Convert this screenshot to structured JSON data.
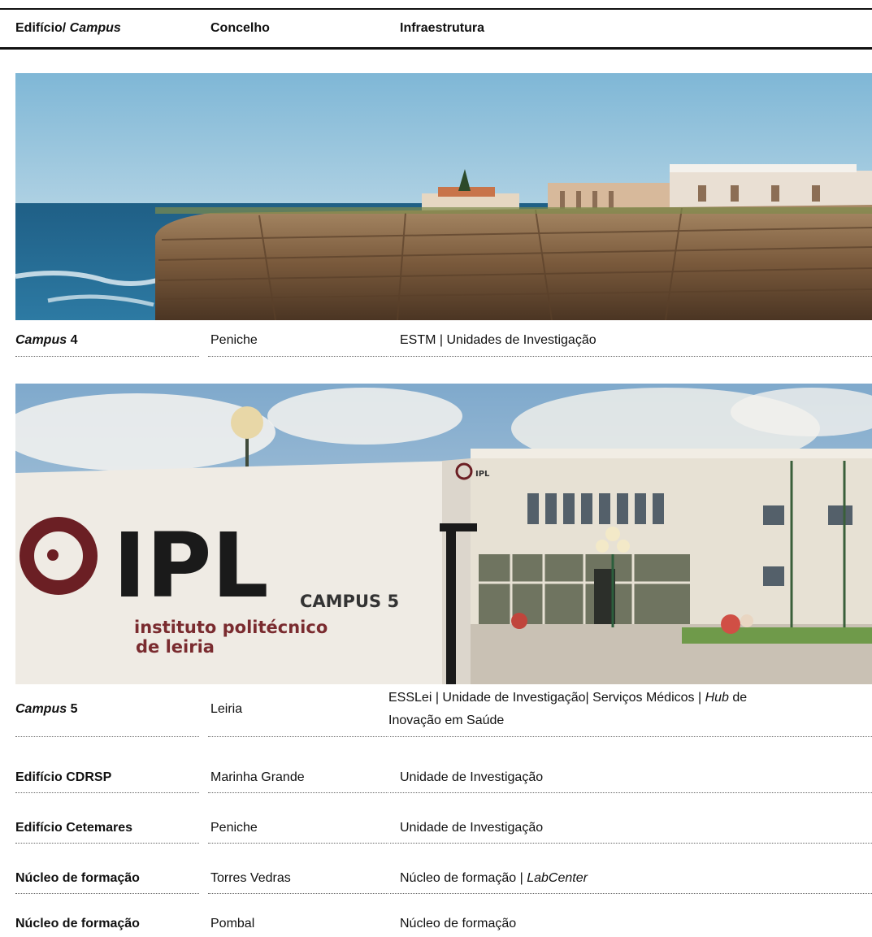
{
  "header": {
    "col1_prefix": "Edifício/ ",
    "col1_italic": "Campus",
    "col2": "Concelho",
    "col3": "Infraestrutura"
  },
  "photos": {
    "ipl_sign": "IPL",
    "ipl_campus": "CAMPUS 5",
    "ipl_line1": "instituto politécnico",
    "ipl_line2": "de leiria",
    "building_sign": "IPL"
  },
  "rows": [
    {
      "name_italic": "Campus",
      "name_bold": " 4",
      "concelho": "Peniche",
      "infra": "ESTM | Unidades de Investigação"
    },
    {
      "name_italic": "Campus",
      "name_bold": " 5",
      "concelho": "Leiria",
      "infra_part1": "ESSLei | Unidade de Investigação| Serviços Médicos | ",
      "infra_italic": "Hub",
      "infra_part2": " de",
      "infra_line2": "Inovação em Saúde"
    },
    {
      "name": "Edifício CDRSP",
      "concelho": "Marinha Grande",
      "infra": "Unidade de Investigação"
    },
    {
      "name": "Edifício Cetemares",
      "concelho": "Peniche",
      "infra": "Unidade de Investigação"
    },
    {
      "name": "Núcleo de formação",
      "concelho": "Torres Vedras",
      "infra_prefix": "Núcleo de formação | ",
      "infra_italic": "LabCenter"
    },
    {
      "name": "Núcleo de formação",
      "concelho": "Pombal",
      "infra": "Núcleo de formação"
    }
  ]
}
